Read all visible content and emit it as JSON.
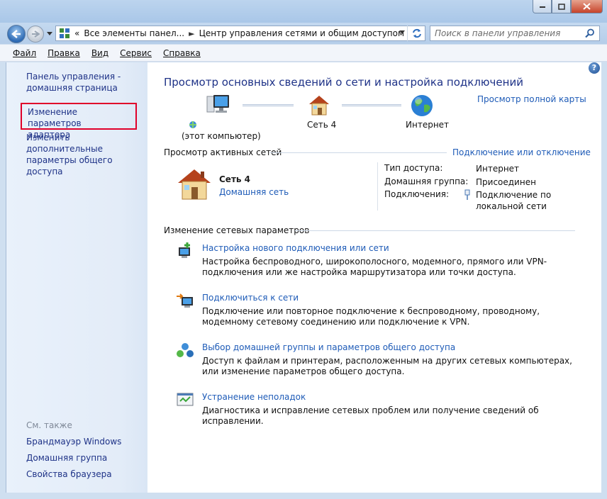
{
  "window": {
    "accent": "#1e5bb7",
    "highlight_color": "#e0002a"
  },
  "address": {
    "overflow": "«",
    "crumb1": "Все элементы панел...",
    "crumb2": "Центр управления сетями и общим доступом"
  },
  "search": {
    "placeholder": "Поиск в панели управления"
  },
  "menu": [
    "Файл",
    "Правка",
    "Вид",
    "Сервис",
    "Справка"
  ],
  "left": {
    "home": [
      "Панель управления -",
      "домашняя страница"
    ],
    "adapter": [
      "Изменение параметров",
      "адаптера"
    ],
    "sharing": [
      "Изменить дополнительные",
      "параметры общего доступа"
    ],
    "see_also": "См. также",
    "see_links": [
      "Брандмауэр Windows",
      "Домашняя группа",
      "Свойства браузера"
    ]
  },
  "main": {
    "title": "Просмотр основных сведений о сети и настройка подключений",
    "full_map": "Просмотр полной карты",
    "map": {
      "computer": "(этот компьютер)",
      "network": "Сеть  4",
      "internet": "Интернет"
    },
    "active": {
      "title": "Просмотр активных сетей",
      "connect_link": "Подключение или отключение",
      "name": "Сеть  4",
      "type": "Домашняя сеть",
      "access_label": "Тип доступа:",
      "access_value": "Интернет",
      "group_label": "Домашняя группа:",
      "group_value": "Присоединен",
      "conn_label": "Подключения:",
      "conn_value": [
        "Подключение по",
        "локальной сети"
      ]
    },
    "change": {
      "title": "Изменение сетевых параметров",
      "tasks": [
        {
          "label": "Настройка нового подключения или сети",
          "desc": "Настройка беспроводного, широкополосного, модемного, прямого или VPN-подключения или же настройка маршрутизатора или точки доступа."
        },
        {
          "label": "Подключиться к сети",
          "desc": "Подключение или повторное подключение к беспроводному, проводному, модемному сетевому соединению или подключение к VPN."
        },
        {
          "label": "Выбор домашней группы и параметров общего доступа",
          "desc": "Доступ к файлам и принтерам, расположенным на других сетевых компьютерах, или изменение параметров общего доступа."
        },
        {
          "label": "Устранение неполадок",
          "desc": "Диагностика и исправление сетевых проблем или получение сведений об исправлении."
        }
      ]
    }
  }
}
